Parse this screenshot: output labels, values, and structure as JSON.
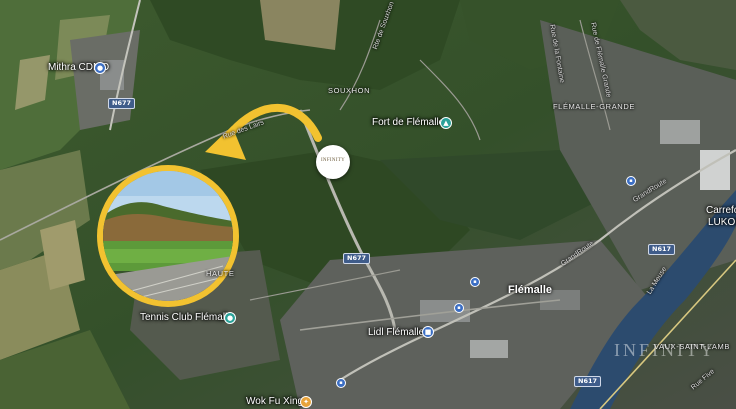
{
  "map": {
    "places": {
      "mithra": "Mithra CDMO",
      "souxhon": "SOUXHON",
      "fort": "Fort de Flémalle",
      "flemalle_grande": "FLÉMALLE-GRANDE",
      "flemalle": "Flémalle",
      "tennis": "Tennis Club Flémalle",
      "lidl": "Lidl Flémalle",
      "wok": "Wok Fu Xing",
      "carrefour": "Carrefo",
      "lukoil": "LUKOIL",
      "vaux": "VAUX-SAINT-LAMB",
      "haute": "HAUTE"
    },
    "streets": {
      "rue_de_la_fontaine": "Rue de la Fontaine",
      "rue_flemalle_grande": "Rue de Flémalle Grande",
      "rue_des_lairs": "Rue des Lairs",
      "rte_de_souxhon": "Rte de Souxhon",
      "grand_route_1": "GrandRoute",
      "grand_route_2": "GrandRoute",
      "la_meuse": "La Meuse",
      "rue_five": "Rue Five"
    },
    "road_shields": {
      "n677_top": "N677",
      "n677_mid": "N677",
      "n617_right": "N617",
      "n617_bottom": "N617"
    },
    "logo": {
      "pin_text": "INFINITY",
      "watermark_text": "INFINITY"
    }
  },
  "colors": {
    "highlight": "#f2c230",
    "road_shield": "#3f5c8a",
    "river": "#2c4b6e",
    "vegetation": "#3a5a2c"
  },
  "icons": {
    "mithra": "business-pin-icon",
    "fort": "landmark-pin-icon",
    "tennis": "sports-pin-icon",
    "lidl": "shopping-cart-pin-icon",
    "wok": "restaurant-pin-icon",
    "transit": "bus-stop-icon",
    "arrow": "curved-arrow-icon"
  }
}
